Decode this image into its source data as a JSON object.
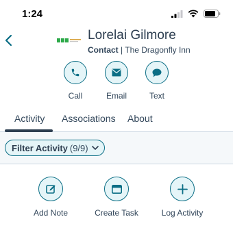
{
  "status_bar": {
    "time": "1:24"
  },
  "contact": {
    "name": "Lorelai Gilmore",
    "type": "Contact",
    "separator": " | ",
    "company": "The Dragonfly Inn"
  },
  "actions": [
    {
      "label": "Call",
      "icon": "phone-icon"
    },
    {
      "label": "Email",
      "icon": "envelope-icon"
    },
    {
      "label": "Text",
      "icon": "chat-bubble-icon"
    }
  ],
  "tabs": [
    {
      "label": "Activity",
      "active": true
    },
    {
      "label": "Associations",
      "active": false
    },
    {
      "label": "About",
      "active": false
    }
  ],
  "filter": {
    "label": "Filter Activity",
    "count": "(9/9)"
  },
  "activity_actions": [
    {
      "label": "Add Note",
      "icon": "edit-note-icon"
    },
    {
      "label": "Create Task",
      "icon": "task-window-icon"
    },
    {
      "label": "Log Activity",
      "icon": "plus-icon"
    }
  ],
  "colors": {
    "accent": "#0b6e85",
    "accent_bg": "#e5f5f8",
    "text": "#33475b",
    "divider": "#cbd6e2",
    "section_bg": "#f5f8fa"
  }
}
